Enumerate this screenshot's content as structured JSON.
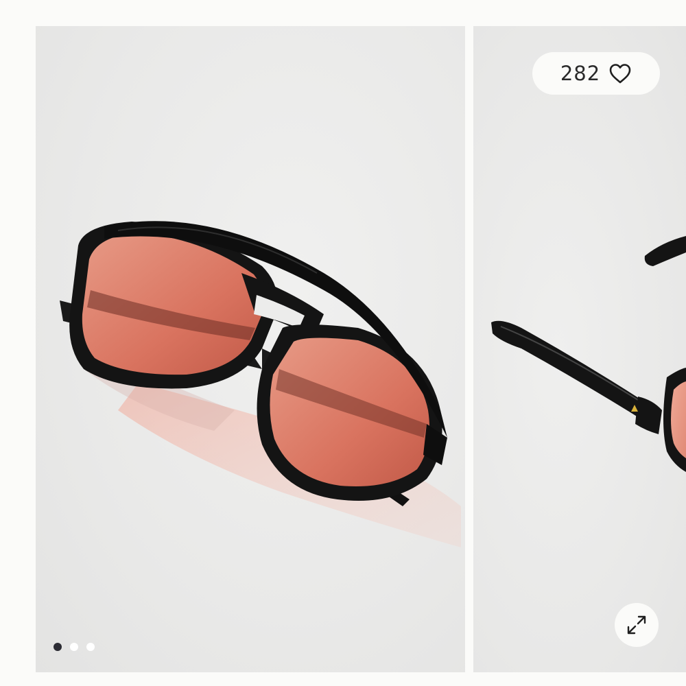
{
  "gallery": {
    "favorite_count": "282",
    "slides_total": 3,
    "active_slide": 1,
    "lens_color": "#d9735f",
    "frame_color": "#141414"
  },
  "icons": {
    "favorite": "heart-outline-icon",
    "expand": "expand-arrows-icon"
  }
}
